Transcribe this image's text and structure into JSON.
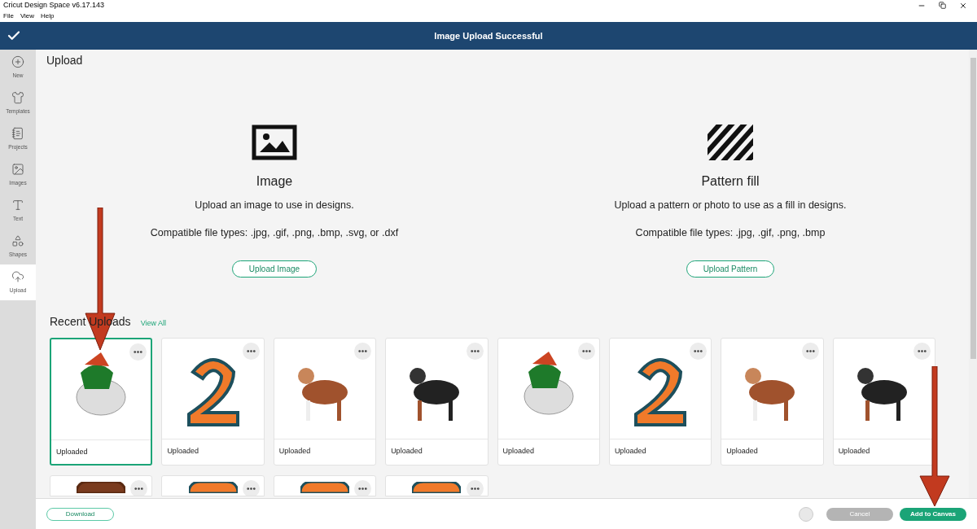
{
  "window": {
    "title": "Cricut Design Space  v6.17.143"
  },
  "menu": [
    "File",
    "View",
    "Help"
  ],
  "header": {
    "title": "Image Upload Successful"
  },
  "sidebar": {
    "items": [
      {
        "label": "New",
        "selected": false
      },
      {
        "label": "Templates",
        "selected": false
      },
      {
        "label": "Projects",
        "selected": false
      },
      {
        "label": "Images",
        "selected": false
      },
      {
        "label": "Text",
        "selected": false
      },
      {
        "label": "Shapes",
        "selected": false
      },
      {
        "label": "Upload",
        "selected": true
      }
    ]
  },
  "page_title": "Upload",
  "options": [
    {
      "kind": "image",
      "title": "Image",
      "description": "Upload an image to use in designs.",
      "file_types": "Compatible file types: .jpg, .gif, .png, .bmp, .svg, or .dxf",
      "button": "Upload Image"
    },
    {
      "kind": "pattern",
      "title": "Pattern fill",
      "description": "Upload a pattern or photo to use as a fill in designs.",
      "file_types": "Compatible file types: .jpg, .gif, .png, .bmp",
      "button": "Upload Pattern"
    }
  ],
  "recent": {
    "title": "Recent Uploads",
    "link": "View All",
    "items": [
      {
        "caption": "Uploaded",
        "selected": true
      },
      {
        "caption": "Uploaded",
        "selected": false
      },
      {
        "caption": "Uploaded",
        "selected": false
      },
      {
        "caption": "Uploaded",
        "selected": false
      },
      {
        "caption": "Uploaded",
        "selected": false
      },
      {
        "caption": "Uploaded",
        "selected": false
      },
      {
        "caption": "Uploaded",
        "selected": false
      },
      {
        "caption": "Uploaded",
        "selected": false
      },
      {
        "selected": false
      },
      {
        "selected": false
      },
      {
        "selected": false
      },
      {
        "selected": false
      }
    ]
  },
  "footer": {
    "download": "Download",
    "cancel": "Cancel",
    "add": "Add to Canvas"
  }
}
